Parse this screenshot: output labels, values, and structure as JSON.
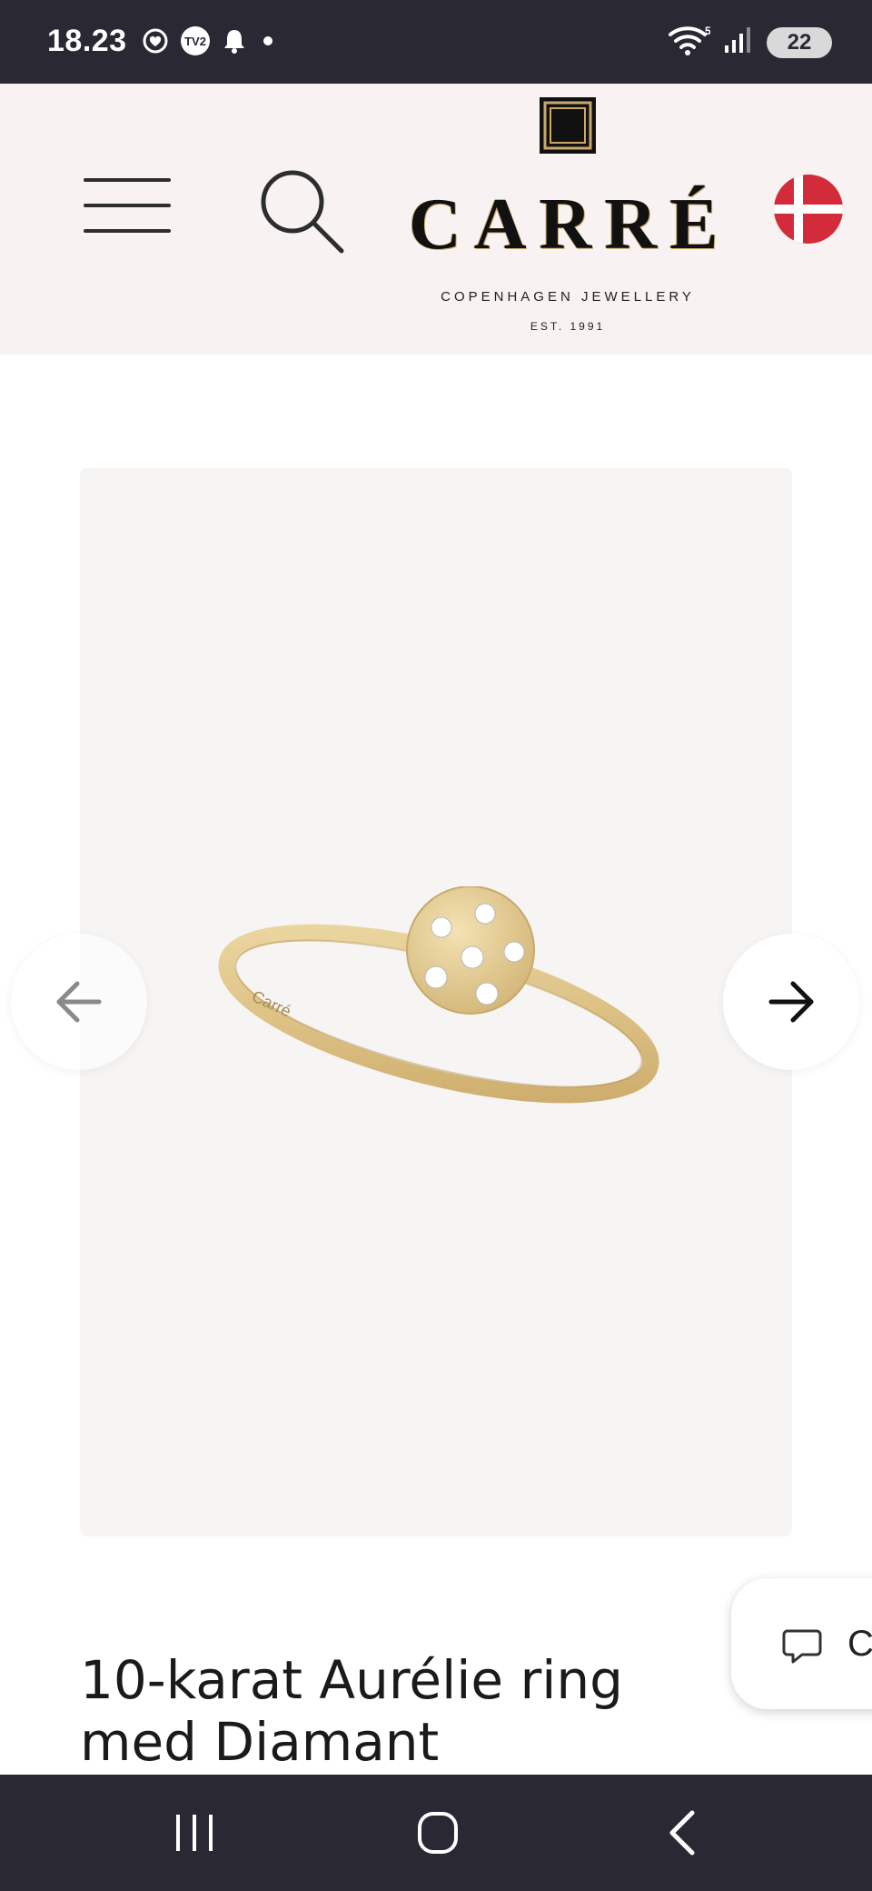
{
  "status_bar": {
    "time": "18.23",
    "left_icons": [
      "heart-monitor-icon",
      "tv2-app-icon",
      "bell-icon",
      "dot-icon"
    ],
    "right_icons": [
      "wifi-icon",
      "signal-icon"
    ],
    "wifi_badge": "5",
    "battery": "22"
  },
  "header": {
    "menu_icon": "hamburger-menu-icon",
    "search_icon": "search-icon",
    "logo": {
      "wordmark": "CARRÉ",
      "tagline": "COPENHAGEN JEWELLERY",
      "established": "EST. 1991"
    },
    "language_flag": "denmark-flag-icon",
    "background": "#f8f2f2"
  },
  "gallery": {
    "image_alt": "10-karat Aurélie ring med Diamant",
    "ring_engraving": "Carré",
    "prev_icon": "arrow-left-icon",
    "next_icon": "arrow-right-icon",
    "background": "#f6f5f4"
  },
  "chat": {
    "icon": "chat-bubble-icon",
    "label": "C"
  },
  "product": {
    "title_line1": "10-karat Aurélie ring",
    "title_line2": "med Diamant"
  },
  "nav_bar": {
    "recents_icon": "recent-apps-icon",
    "home_icon": "home-icon",
    "back_icon": "back-icon"
  },
  "colors": {
    "system_bar": "#2a2833",
    "gold": "#e2c98c",
    "flag_red": "#d42b3a"
  }
}
